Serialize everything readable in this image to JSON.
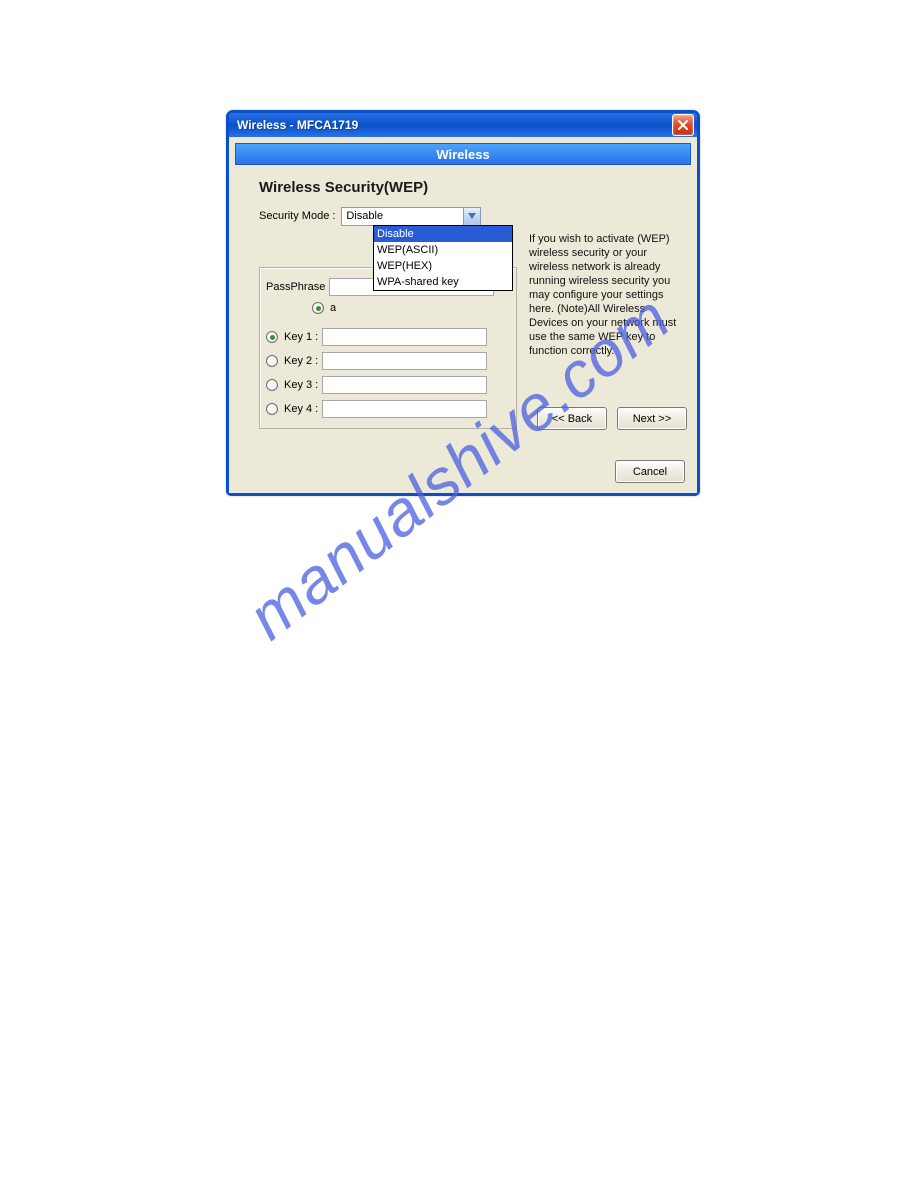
{
  "window": {
    "title": "Wireless - MFCA1719"
  },
  "header": {
    "title": "Wireless"
  },
  "section": {
    "title": "Wireless Security(WEP)"
  },
  "securityMode": {
    "label": "Security Mode :",
    "value": "Disable",
    "options": [
      "Disable",
      "WEP(ASCII)",
      "WEP(HEX)",
      "WPA-shared key"
    ]
  },
  "help": {
    "text": "If you wish to activate (WEP) wireless security or your wireless network is already running wireless security you may configure your settings here. (Note)All Wireless Devices on your network must use the same WEP key to function correctly."
  },
  "passphrase": {
    "label": "PassPhrase",
    "value": "",
    "optionPrefix": "a"
  },
  "keys": {
    "items": [
      {
        "label": "Key 1 :",
        "value": "",
        "selected": true
      },
      {
        "label": "Key 2 :",
        "value": "",
        "selected": false
      },
      {
        "label": "Key 3 :",
        "value": "",
        "selected": false
      },
      {
        "label": "Key 4 :",
        "value": "",
        "selected": false
      }
    ]
  },
  "buttons": {
    "back": "<< Back",
    "next": "Next >>",
    "cancel": "Cancel"
  },
  "watermark": "manualshive.com"
}
